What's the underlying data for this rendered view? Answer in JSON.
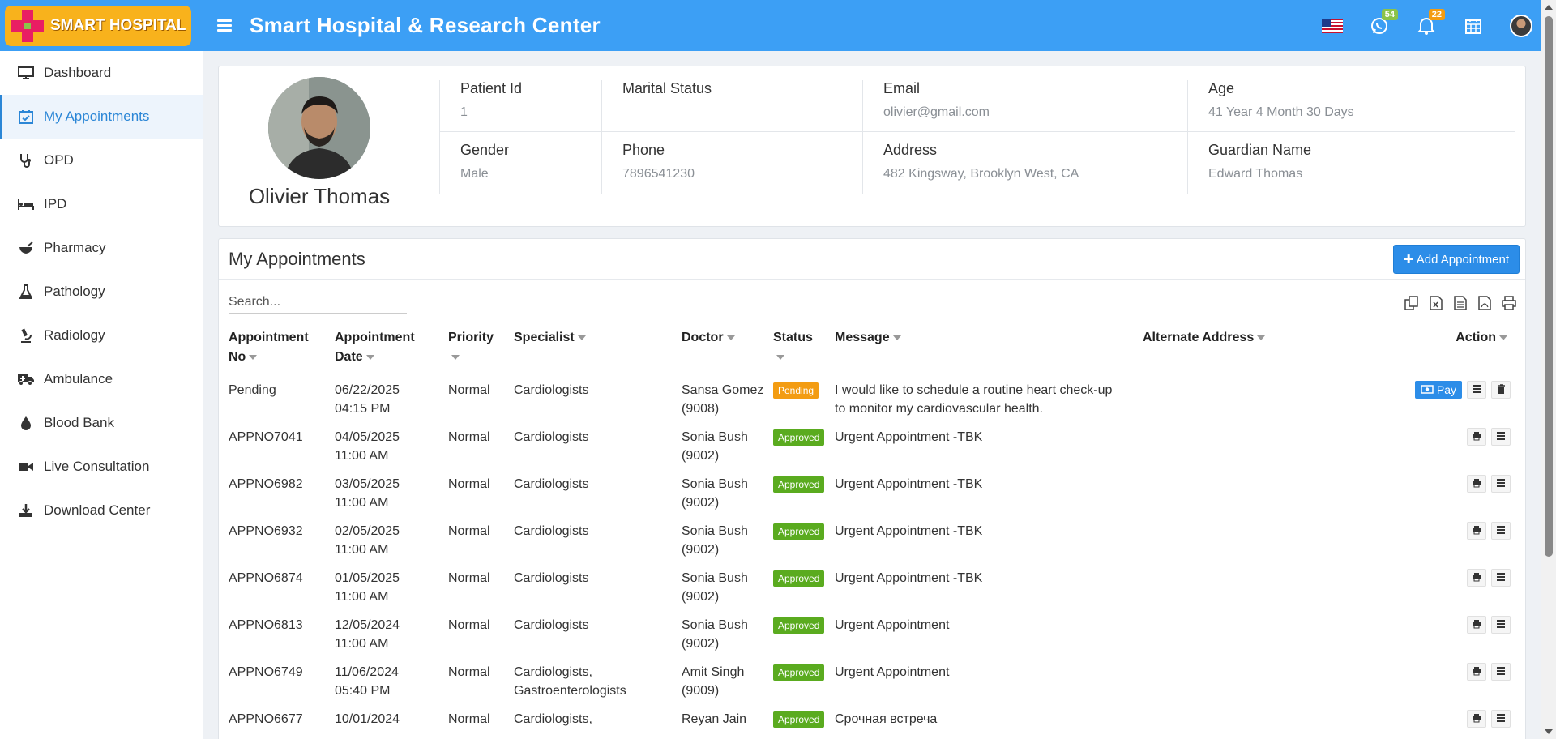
{
  "header": {
    "logo_text": "SMART HOSPITAL",
    "title": "Smart Hospital & Research Center",
    "whatsapp_count": "54",
    "notification_count": "22"
  },
  "sidebar": {
    "items": [
      {
        "label": "Dashboard",
        "icon": "monitor-icon"
      },
      {
        "label": "My Appointments",
        "icon": "calendar-check-icon"
      },
      {
        "label": "OPD",
        "icon": "stethoscope-icon"
      },
      {
        "label": "IPD",
        "icon": "bed-icon"
      },
      {
        "label": "Pharmacy",
        "icon": "mortar-pestle-icon"
      },
      {
        "label": "Pathology",
        "icon": "flask-icon"
      },
      {
        "label": "Radiology",
        "icon": "microscope-icon"
      },
      {
        "label": "Ambulance",
        "icon": "ambulance-icon"
      },
      {
        "label": "Blood Bank",
        "icon": "droplet-icon"
      },
      {
        "label": "Live Consultation",
        "icon": "video-icon"
      },
      {
        "label": "Download Center",
        "icon": "download-icon"
      }
    ]
  },
  "profile": {
    "name": "Olivier Thomas",
    "patient_id_label": "Patient Id",
    "patient_id": "1",
    "marital_status_label": "Marital Status",
    "marital_status": "",
    "email_label": "Email",
    "email": "olivier@gmail.com",
    "age_label": "Age",
    "age": "41 Year 4 Month 30 Days",
    "gender_label": "Gender",
    "gender": "Male",
    "phone_label": "Phone",
    "phone": "7896541230",
    "address_label": "Address",
    "address": "482 Kingsway, Brooklyn West, CA",
    "guardian_label": "Guardian Name",
    "guardian": "Edward Thomas"
  },
  "appointments": {
    "title": "My Appointments",
    "add_button": "Add Appointment",
    "search_placeholder": "Search...",
    "columns": {
      "no": [
        "Appointment",
        "No"
      ],
      "date": [
        "Appointment",
        "Date"
      ],
      "priority": "Priority",
      "specialist": "Specialist",
      "doctor": "Doctor",
      "status": "Status",
      "message": "Message",
      "alt_address": "Alternate Address",
      "action": "Action"
    },
    "pay_label": "Pay",
    "rows": [
      {
        "no": "Pending",
        "date": "06/22/2025",
        "time": "04:15 PM",
        "priority": "Normal",
        "specialist": [
          "Cardiologists"
        ],
        "doctor": "Sansa Gomez",
        "doctor_id": "(9008)",
        "status": "Pending",
        "message": [
          "I would like to schedule a routine heart check-up",
          "to monitor my cardiovascular health."
        ],
        "alt": ""
      },
      {
        "no": "APPNO7041",
        "date": "04/05/2025",
        "time": "11:00 AM",
        "priority": "Normal",
        "specialist": [
          "Cardiologists"
        ],
        "doctor": "Sonia Bush",
        "doctor_id": "(9002)",
        "status": "Approved",
        "message": [
          "Urgent Appointment -TBK"
        ],
        "alt": ""
      },
      {
        "no": "APPNO6982",
        "date": "03/05/2025",
        "time": "11:00 AM",
        "priority": "Normal",
        "specialist": [
          "Cardiologists"
        ],
        "doctor": "Sonia Bush",
        "doctor_id": "(9002)",
        "status": "Approved",
        "message": [
          "Urgent Appointment -TBK"
        ],
        "alt": ""
      },
      {
        "no": "APPNO6932",
        "date": "02/05/2025",
        "time": "11:00 AM",
        "priority": "Normal",
        "specialist": [
          "Cardiologists"
        ],
        "doctor": "Sonia Bush",
        "doctor_id": "(9002)",
        "status": "Approved",
        "message": [
          "Urgent Appointment -TBK"
        ],
        "alt": ""
      },
      {
        "no": "APPNO6874",
        "date": "01/05/2025",
        "time": "11:00 AM",
        "priority": "Normal",
        "specialist": [
          "Cardiologists"
        ],
        "doctor": "Sonia Bush",
        "doctor_id": "(9002)",
        "status": "Approved",
        "message": [
          "Urgent Appointment -TBK"
        ],
        "alt": ""
      },
      {
        "no": "APPNO6813",
        "date": "12/05/2024",
        "time": "11:00 AM",
        "priority": "Normal",
        "specialist": [
          "Cardiologists"
        ],
        "doctor": "Sonia Bush",
        "doctor_id": "(9002)",
        "status": "Approved",
        "message": [
          "Urgent Appointment"
        ],
        "alt": ""
      },
      {
        "no": "APPNO6749",
        "date": "11/06/2024",
        "time": "05:40 PM",
        "priority": "Normal",
        "specialist": [
          "Cardiologists,",
          "Gastroenterologists"
        ],
        "doctor": "Amit Singh",
        "doctor_id": "(9009)",
        "status": "Approved",
        "message": [
          "Urgent Appointment"
        ],
        "alt": ""
      },
      {
        "no": "APPNO6677",
        "date": "10/01/2024",
        "time": "",
        "priority": "Normal",
        "specialist": [
          "Cardiologists,"
        ],
        "doctor": "Reyan Jain",
        "doctor_id": "",
        "status": "Approved",
        "message": [
          "Срочная встреча"
        ],
        "alt": ""
      }
    ]
  },
  "colors": {
    "header_bg": "#3c9ff5",
    "accent": "#2c8de8",
    "approved": "#5aab1f",
    "pending": "#f39c12"
  }
}
